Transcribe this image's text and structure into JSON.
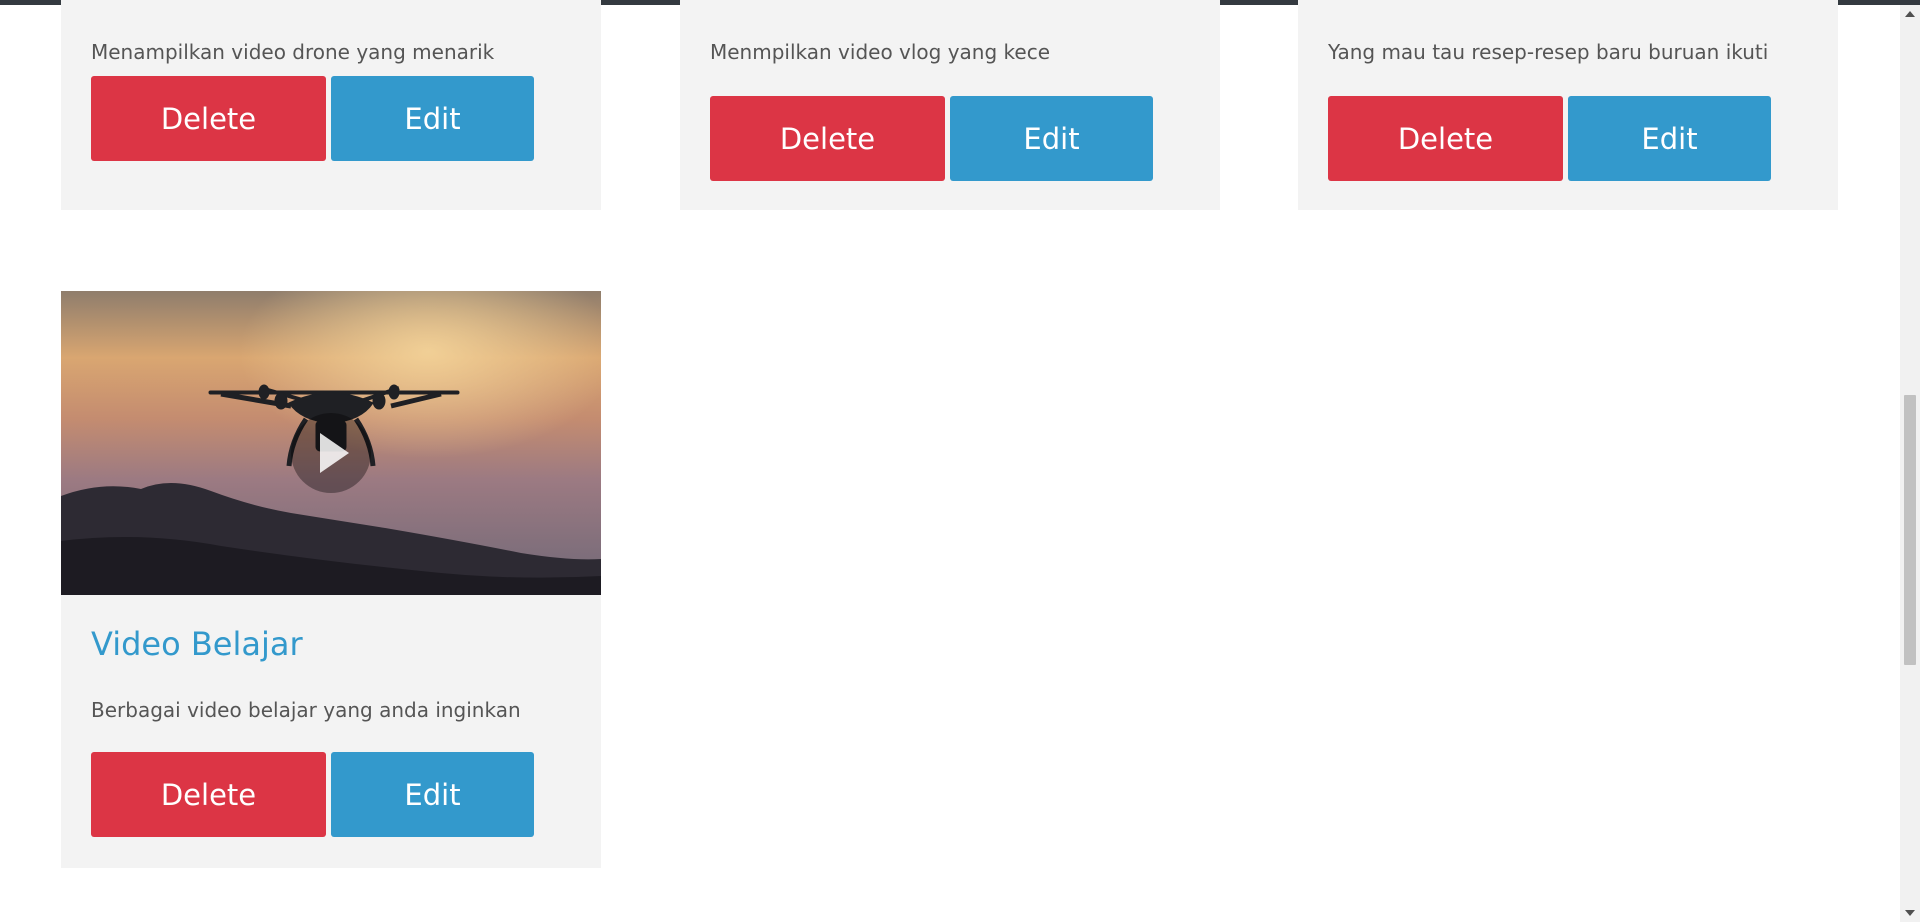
{
  "cards": [
    {
      "title": "",
      "description": "Menampilkan video drone yang menarik",
      "delete_label": "Delete",
      "edit_label": "Edit"
    },
    {
      "title": "",
      "description": "Menmpilkan video vlog yang kece",
      "delete_label": "Delete",
      "edit_label": "Edit"
    },
    {
      "title": "",
      "description": "Yang mau tau resep-resep baru buruan ikuti",
      "delete_label": "Delete",
      "edit_label": "Edit"
    },
    {
      "title": "Video Belajar",
      "description": "Berbagai video belajar yang anda inginkan",
      "delete_label": "Delete",
      "edit_label": "Edit",
      "thumbnail": "drone-over-sunset-video"
    }
  ],
  "colors": {
    "delete": "#dc3545",
    "edit": "#3399cc",
    "title": "#3399cc",
    "card_bg": "#f3f3f3"
  },
  "icons": {
    "play": "play-icon"
  }
}
